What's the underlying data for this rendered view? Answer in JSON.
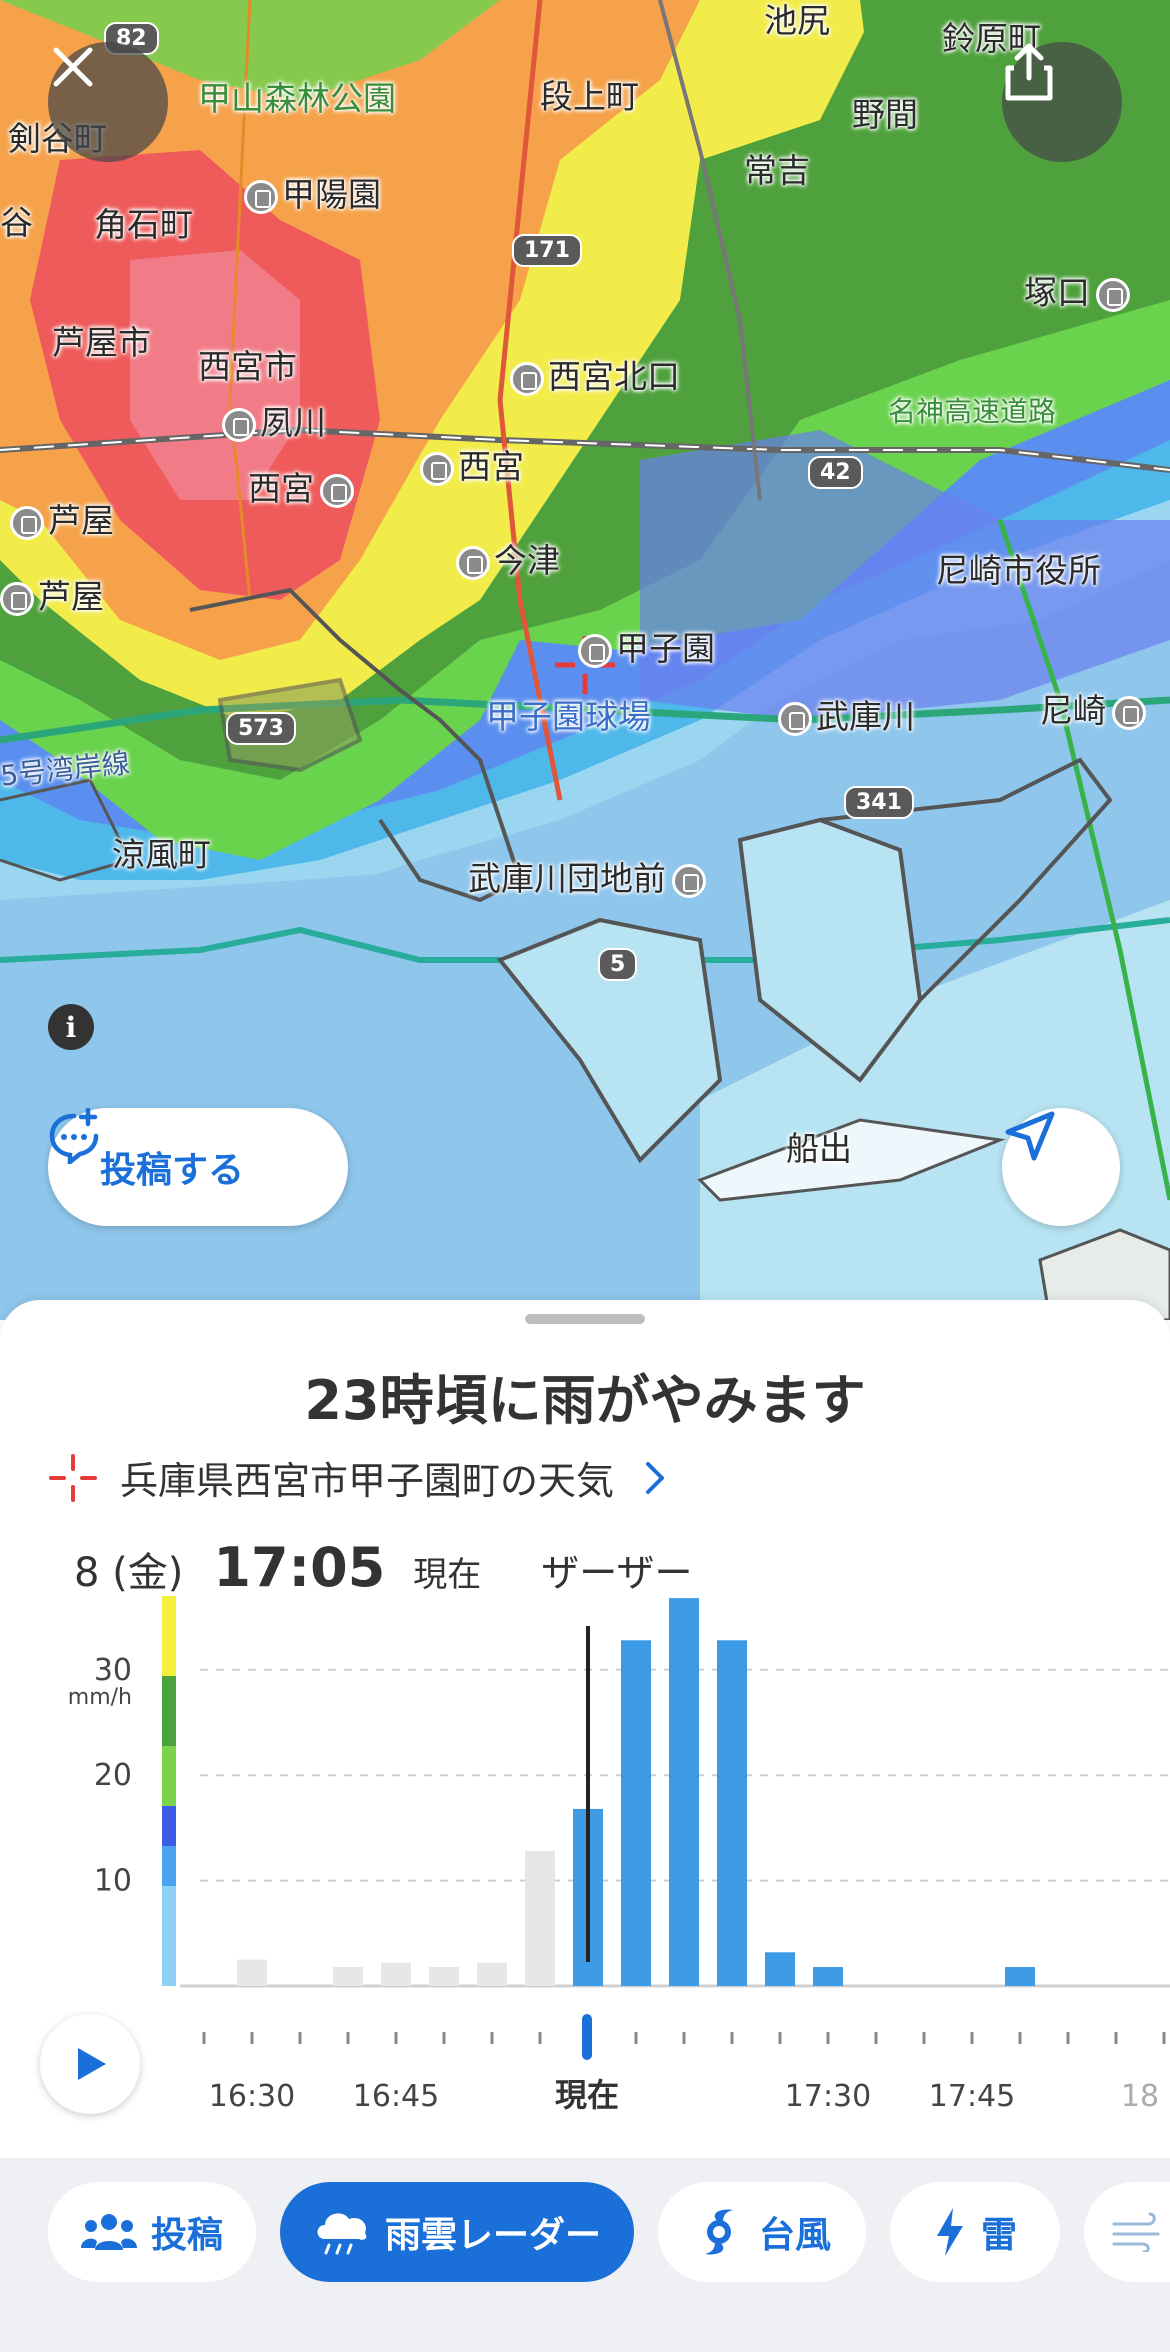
{
  "map": {
    "labels": {
      "kenyacho": "剣谷町",
      "kabutoyama": "甲山森林公園",
      "dangami": "段上町",
      "ikejiri": "池尻",
      "suzuhara": "鈴原町",
      "noma": "野間",
      "tsuneyoshi": "常吉",
      "kabutoen": "甲陽園",
      "kakuishi": "角石町",
      "tani": "谷",
      "tsukaguchi": "塚口",
      "ashiyashi": "芦屋市",
      "nishinomiyashi": "西宮市",
      "nishinomiyakitaguchi": "西宮北口",
      "meishin": "名神高速道路",
      "shukugawa": "夙川",
      "nishinomiya_jr": "西宮",
      "nishinomiya_hs": "西宮",
      "ashiya1": "芦屋",
      "ashiya2": "芦屋",
      "imazu": "今津",
      "amagasaki_office": "尼崎市役所",
      "koshien": "甲子園",
      "koshien_stadium": "甲子園球場",
      "mukogawa": "武庫川",
      "amagasaki": "尼崎",
      "wangan": "5号湾岸線",
      "suzukaze": "涼風町",
      "mukogawa_danchi": "武庫川団地前",
      "funade": "船出"
    },
    "shields": {
      "r82": "82",
      "r171": "171",
      "r42": "42",
      "r573": "573",
      "r341": "341",
      "r5": "5"
    },
    "post_button_label": "投稿する",
    "info_label": "i"
  },
  "sheet": {
    "headline": "23時頃に雨がやみます",
    "location": "兵庫県西宮市甲子園町の天気",
    "date": "8 (金)",
    "time": "17:05",
    "now": "現在",
    "weather": "ザーザー"
  },
  "chart_data": {
    "type": "bar",
    "xlabel": "",
    "ylabel": "mm/h",
    "ylim": [
      0,
      37
    ],
    "yticks": [
      10,
      20,
      30
    ],
    "x_labels": [
      "16:30",
      "16:45",
      "現在",
      "17:30",
      "17:45",
      "18"
    ],
    "series": [
      {
        "role": "past",
        "color": "#e6e6e6",
        "bars": [
          {
            "time": "16:30",
            "value": 2.5
          },
          {
            "time": "16:40",
            "value": 1.8
          },
          {
            "time": "16:45",
            "value": 2.2
          },
          {
            "time": "16:50",
            "value": 1.8
          },
          {
            "time": "16:55",
            "value": 2.2
          },
          {
            "time": "17:00",
            "value": 12.8
          }
        ]
      },
      {
        "role": "forecast",
        "color": "#3d9be6",
        "bars": [
          {
            "time": "17:05",
            "value": 16.8
          },
          {
            "time": "17:10",
            "value": 32.8
          },
          {
            "time": "17:15",
            "value": 36.8
          },
          {
            "time": "17:20",
            "value": 32.8
          },
          {
            "time": "17:25",
            "value": 3.2
          },
          {
            "time": "17:30",
            "value": 1.8
          },
          {
            "time": "17:50",
            "value": 1.8
          }
        ]
      }
    ],
    "scale_colors": [
      "#f4ef3b",
      "#4ca33b",
      "#7ad34b",
      "#3b5ce6",
      "#4aa2f0",
      "#8fd1f5"
    ]
  },
  "tabs": [
    {
      "label": "投稿",
      "icon": "people-icon"
    },
    {
      "label": "雨雲レーダー",
      "icon": "rain-cloud-icon",
      "active": true
    },
    {
      "label": "台風",
      "icon": "typhoon-icon"
    },
    {
      "label": "雷",
      "icon": "lightning-icon"
    }
  ]
}
